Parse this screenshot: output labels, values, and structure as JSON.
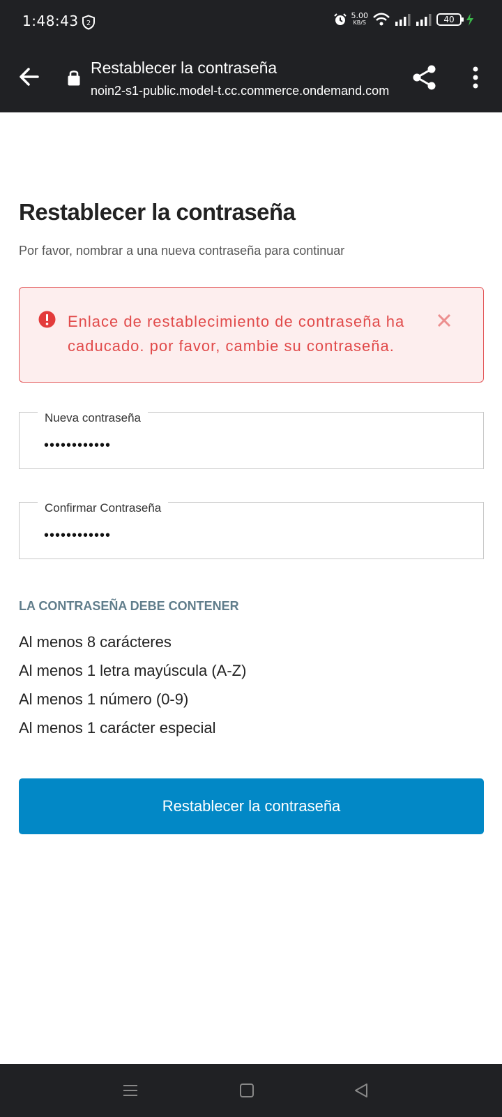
{
  "status_bar": {
    "time": "1:48:43",
    "net_speed": "5.00",
    "net_unit": "KB/S",
    "battery": "40"
  },
  "toolbar": {
    "title": "Restablecer la contraseña",
    "url": "noin2-s1-public.model-t.cc.commerce.ondemand.com"
  },
  "page": {
    "title": "Restablecer la contraseña",
    "subtitle": "Por favor, nombrar a una nueva contraseña para continuar"
  },
  "alert": {
    "message": "Enlace de restablecimiento de contraseña ha caducado. por favor, cambie su contraseña.",
    "color": "#e14a4a"
  },
  "fields": {
    "new_password": {
      "label": "Nueva contraseña",
      "value": "••••••••••••"
    },
    "confirm_password": {
      "label": "Confirmar Contraseña",
      "value": "••••••••••••"
    }
  },
  "requirements": {
    "heading": "LA CONTRASEÑA DEBE CONTENER",
    "items": [
      "Al menos 8 carácteres",
      "Al menos 1 letra mayúscula (A-Z)",
      "Al menos 1 número (0-9)",
      "Al menos 1 carácter especial"
    ]
  },
  "submit": {
    "label": "Restablecer la contraseña",
    "color": "#0288c6"
  }
}
